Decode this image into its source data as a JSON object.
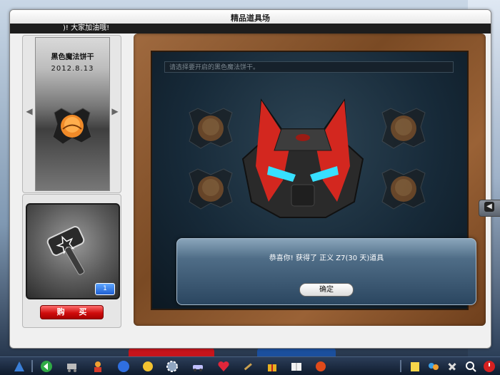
{
  "window": {
    "title": "精品道具场",
    "marquee": ")! 大家加油哦!"
  },
  "item": {
    "name": "黑色魔法饼干",
    "date": "2012.8.13",
    "prev_arrow": "◀",
    "next_arrow": "▶"
  },
  "bonus": {
    "count": "1",
    "buy_label": "购 买"
  },
  "stage": {
    "input_placeholder": "请选择要开启的黑色魔法饼干。"
  },
  "dialog": {
    "message": "恭喜你! 获得了 正义 Z7(30 天)道具",
    "confirm_label": "确定"
  },
  "side_tab": {
    "glyph": "◀"
  },
  "taskbar": {
    "icons": [
      "home-icon",
      "back-icon",
      "shop-cart-icon",
      "character-icon",
      "globe-icon",
      "pet-icon",
      "settings-gear-icon",
      "car-icon",
      "heart-icon",
      "tools-icon",
      "gift-icon",
      "book-icon",
      "kart-icon",
      "note-icon",
      "friends-icon",
      "wrench-icon",
      "search-icon",
      "power-icon"
    ]
  },
  "colors": {
    "buy_red": "#d00d0d",
    "frame_wood": "#7a4a24",
    "stage_dark": "#172a39",
    "badge_blue": "#1f5fd1"
  }
}
